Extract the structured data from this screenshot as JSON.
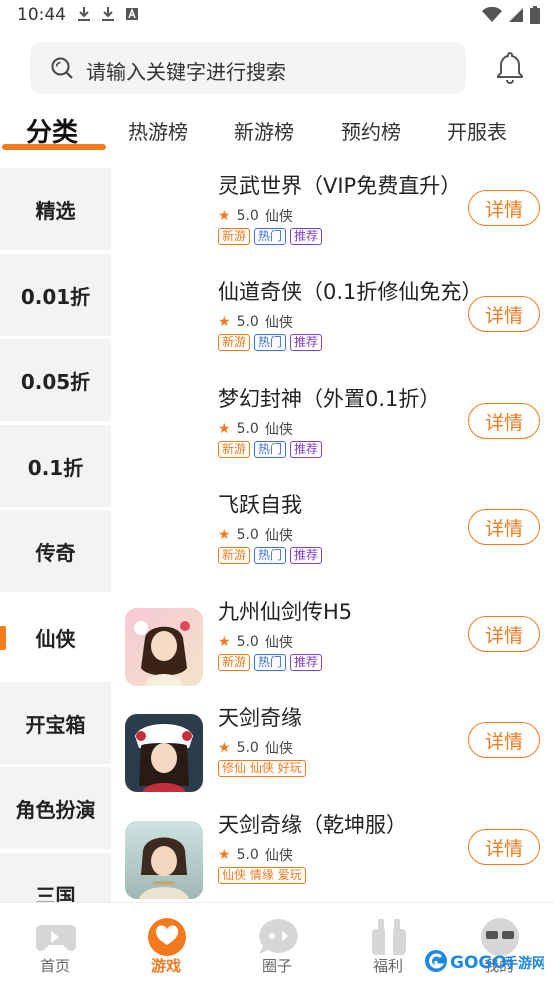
{
  "status_bar": {
    "time": "10:44"
  },
  "search": {
    "placeholder": "请输入关键字进行搜索"
  },
  "tabs": [
    {
      "label": "分类",
      "active": true
    },
    {
      "label": "热游榜"
    },
    {
      "label": "新游榜"
    },
    {
      "label": "预约榜"
    },
    {
      "label": "开服表"
    }
  ],
  "sidebar": {
    "items": [
      {
        "label": "精选"
      },
      {
        "label": "0.01折"
      },
      {
        "label": "0.05折"
      },
      {
        "label": "0.1折"
      },
      {
        "label": "传奇"
      },
      {
        "label": "仙侠",
        "active": true
      },
      {
        "label": "开宝箱"
      },
      {
        "label": "角色扮演"
      },
      {
        "label": "三国"
      }
    ]
  },
  "games": [
    {
      "title": "灵武世界（VIP免费直升）",
      "rating": "5.0",
      "category": "仙侠",
      "tags": [
        "新游",
        "热门",
        "推荐"
      ],
      "detail": "详情"
    },
    {
      "title": "仙道奇侠（0.1折修仙免充）",
      "rating": "5.0",
      "category": "仙侠",
      "tags": [
        "新游",
        "热门",
        "推荐"
      ],
      "detail": "详情"
    },
    {
      "title": "梦幻封神（外置0.1折）",
      "rating": "5.0",
      "category": "仙侠",
      "tags": [
        "新游",
        "热门",
        "推荐"
      ],
      "detail": "详情"
    },
    {
      "title": "飞跃自我",
      "rating": "5.0",
      "category": "仙侠",
      "tags": [
        "新游",
        "热门",
        "推荐"
      ],
      "detail": "详情"
    },
    {
      "title": "九州仙剑传H5",
      "rating": "5.0",
      "category": "仙侠",
      "tags": [
        "新游",
        "热门",
        "推荐"
      ],
      "detail": "详情"
    },
    {
      "title": "天剑奇缘",
      "rating": "5.0",
      "category": "仙侠",
      "tags": [
        "修仙 仙侠 好玩"
      ],
      "detail": "详情"
    },
    {
      "title": "天剑奇缘（乾坤服）",
      "rating": "5.0",
      "category": "仙侠",
      "tags": [
        "仙侠 情缘 爱玩"
      ],
      "detail": "详情"
    }
  ],
  "bottom_nav": [
    {
      "label": "首页",
      "icon": "gamepad-icon"
    },
    {
      "label": "游戏",
      "icon": "heart-chat-icon",
      "active": true
    },
    {
      "label": "圈子",
      "icon": "chat-bubble-icon"
    },
    {
      "label": "福利",
      "icon": "gift-icon"
    },
    {
      "label": "我的",
      "icon": "profile-icon"
    }
  ],
  "watermark": {
    "text": "GOGO手游网"
  },
  "colors": {
    "accent": "#f47a1e",
    "tag_blue": "#3b6fd8",
    "tag_purple": "#7b3fd1"
  }
}
